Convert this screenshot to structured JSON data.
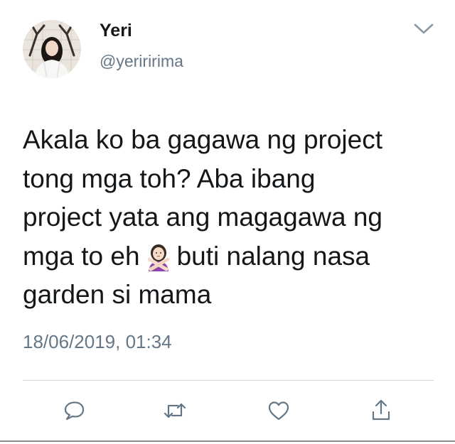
{
  "author": {
    "display_name": "Yeri",
    "handle": "@yeriririma",
    "avatar_icon": "profile-photo"
  },
  "tweet": {
    "lines": [
      "Akala ko ba gagawa ng project",
      "tong mga toh? Aba ibang",
      "project yata ang magagawa ng"
    ],
    "line4_before_emoji": "mga to eh",
    "emoji_icon": "person-gesturing-no-emoji",
    "line4_after_emoji": "buti nalang nasa",
    "line5": "garden si mama",
    "timestamp": "18/06/2019, 01:34"
  },
  "actions": {
    "reply_icon": "reply-icon",
    "retweet_icon": "retweet-icon",
    "like_icon": "like-icon",
    "share_icon": "share-icon"
  },
  "colors": {
    "text": "#14171a",
    "secondary_text": "#657786",
    "icon": "#657786",
    "divider": "#d3d7db"
  }
}
